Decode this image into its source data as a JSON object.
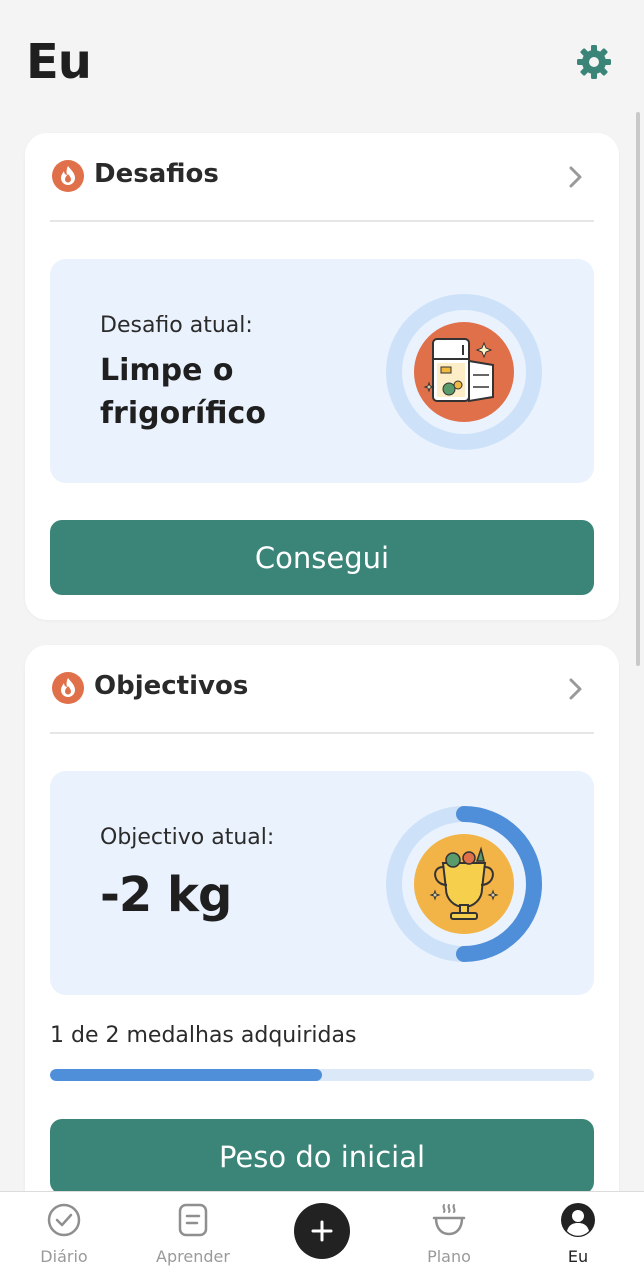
{
  "header": {
    "title": "Eu",
    "settings_icon": "gear-icon"
  },
  "colors": {
    "accent": "#3a8478",
    "flame": "#e0704a",
    "panel_bg": "#eaf2fd",
    "progress": "#4f8fd9"
  },
  "challenges": {
    "title": "Desafios",
    "current_label": "Desafio atual:",
    "current_value_line1": "Limpe o",
    "current_value_line2": "frigorífico",
    "illustration": "fridge-illustration",
    "button": "Consegui"
  },
  "goals": {
    "title": "Objectivos",
    "current_label": "Objectivo atual:",
    "current_value": "-2 kg",
    "illustration": "trophy-illustration",
    "medals_text": "1 de 2 medalhas adquiridas",
    "medals_progress": 0.5,
    "button": "Peso do inicial"
  },
  "nav": {
    "items": [
      {
        "label": "Diário",
        "icon": "check-circle-icon"
      },
      {
        "label": "Aprender",
        "icon": "book-icon"
      },
      {
        "label": "Plano",
        "icon": "bowl-icon"
      },
      {
        "label": "Eu",
        "icon": "profile-icon"
      }
    ],
    "add_icon": "plus-icon",
    "active": "Eu"
  }
}
